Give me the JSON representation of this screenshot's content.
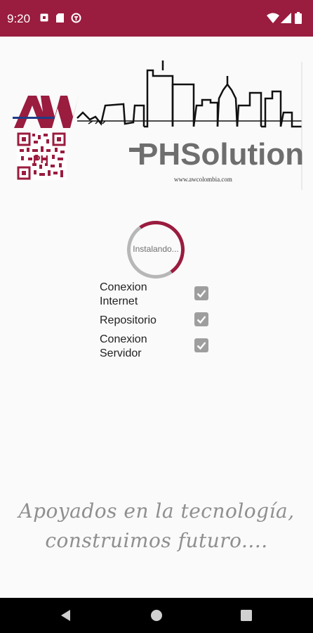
{
  "status_bar": {
    "time": "9:20",
    "background": "#9a1c3e",
    "left_icons": [
      "notification-square-icon",
      "sd-card-icon",
      "vpn-key-icon"
    ],
    "right_icons": [
      "wifi-icon",
      "signal-icon",
      "battery-icon"
    ]
  },
  "header": {
    "logo_text": "AW",
    "brand_text": "PHSolution",
    "website": "www.awcolombia.com",
    "accent_color": "#9a1c3e"
  },
  "progress": {
    "label": "Instalando..."
  },
  "checklist": [
    {
      "label": "Conexion Internet",
      "checked": true
    },
    {
      "label": "Repositorio",
      "checked": true
    },
    {
      "label": "Conexion Servidor",
      "checked": true
    }
  ],
  "tagline": {
    "line1": "Apoyados en la tecnología,",
    "line2": "construimos futuro...."
  },
  "nav_bar": {
    "icons": [
      "back-icon",
      "home-icon",
      "recents-icon"
    ]
  }
}
